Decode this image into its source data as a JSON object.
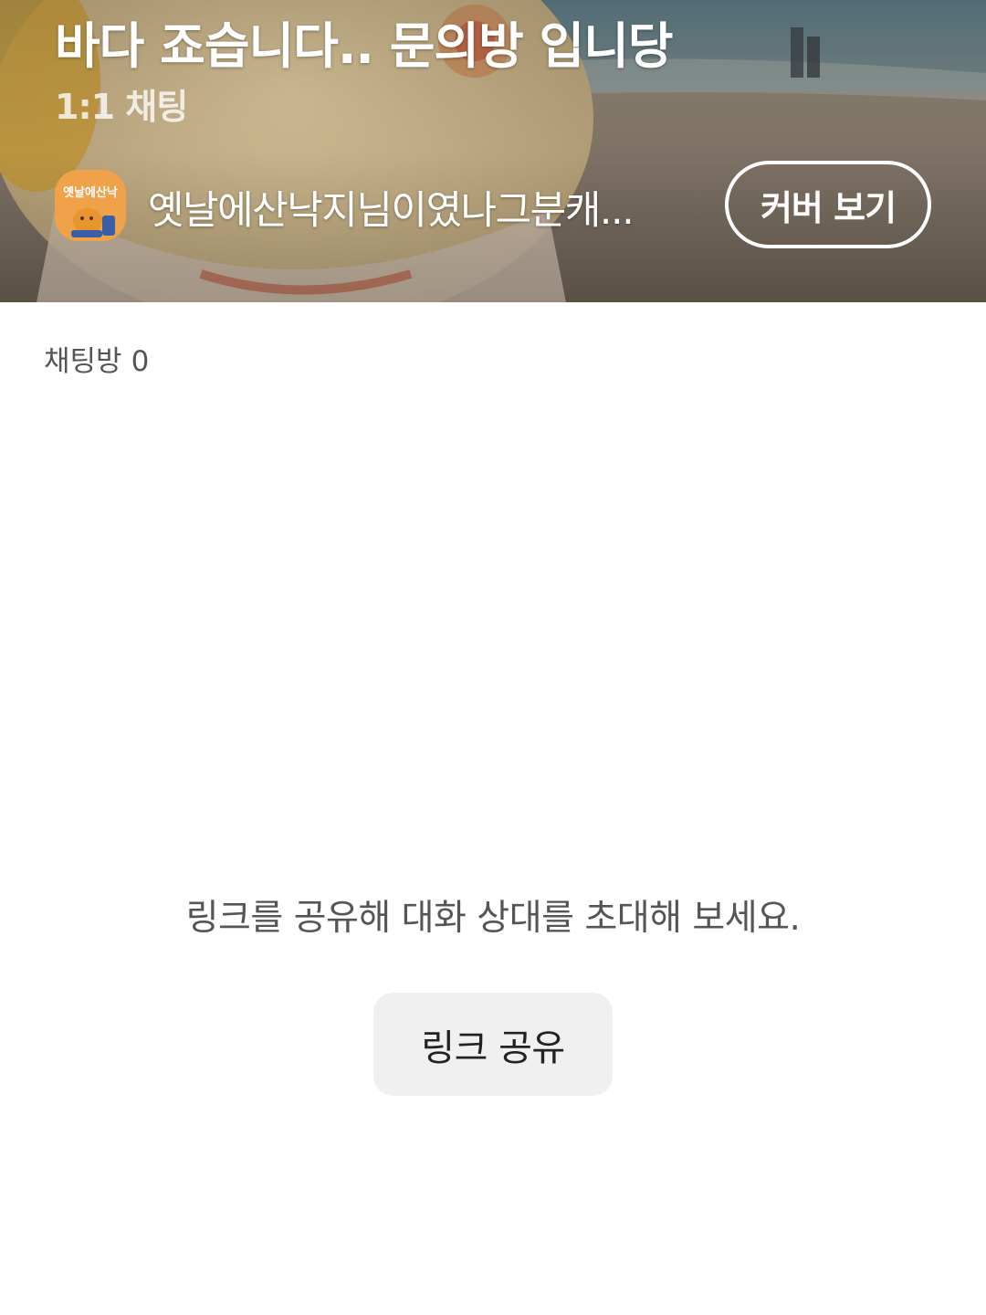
{
  "cover": {
    "title": "바다 죠습니다.. 문의방 입니당",
    "room_type": "1:1 채팅",
    "owner": {
      "avatar_text": "옛날에산낙",
      "name": "옛날에산낙지님이였나그분캐..."
    },
    "view_cover_label": "커버 보기"
  },
  "rooms": {
    "label": "채팅방",
    "count": "0"
  },
  "empty_state": {
    "message": "링크를 공유해 대화 상대를 초대해 보세요.",
    "share_label": "링크 공유"
  },
  "colors": {
    "accent_text": "#555555",
    "button_bg": "#f0f0f0",
    "avatar_bg": "#f0a24a"
  }
}
